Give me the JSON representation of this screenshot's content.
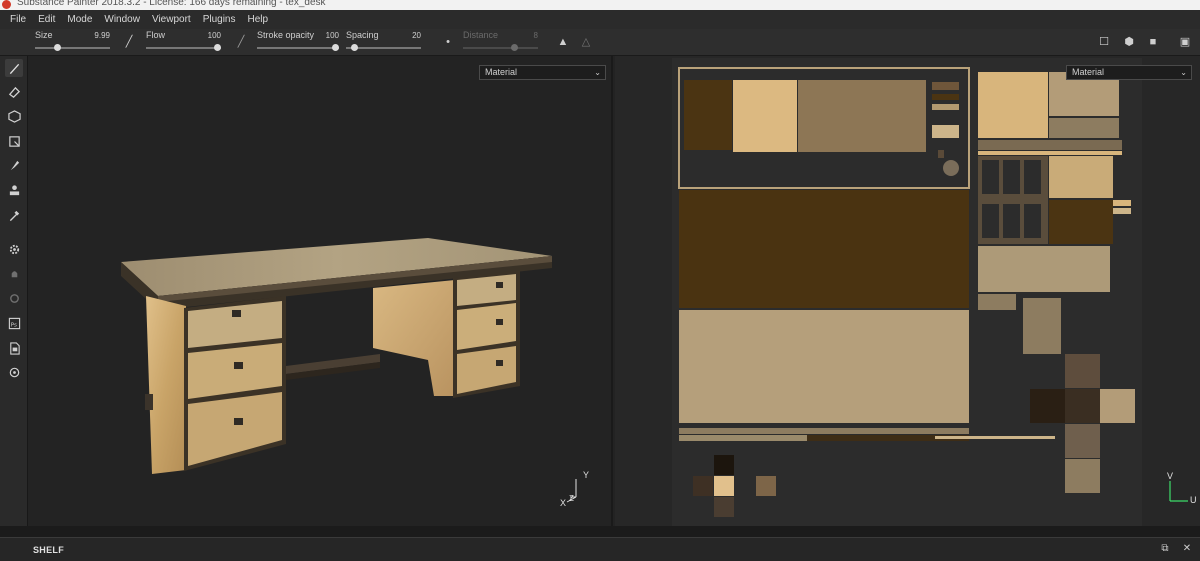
{
  "window": {
    "title": "Substance Painter 2018.3.2 - License: 166 days remaining - tex_desk"
  },
  "menu": {
    "items": [
      "File",
      "Edit",
      "Mode",
      "Window",
      "Viewport",
      "Plugins",
      "Help"
    ]
  },
  "toolbar": {
    "size": {
      "label": "Size",
      "value": "9.99",
      "level": 0.28
    },
    "flow": {
      "label": "Flow",
      "value": "100",
      "level": 1.0
    },
    "stroke_opacity": {
      "label": "Stroke opacity",
      "value": "100",
      "level": 1.0
    },
    "spacing": {
      "label": "Spacing",
      "value": "20",
      "level": 0.08
    },
    "distance": {
      "label": "Distance",
      "value": "8",
      "level": 0.7
    }
  },
  "viewport3d": {
    "channel_select": "Material",
    "axis": {
      "x": "X",
      "y": "Y",
      "z": "Z"
    }
  },
  "viewport2d": {
    "channel_select": "Material",
    "axis": {
      "y": "V",
      "x": "U"
    }
  },
  "shelf": {
    "title": "SHELF"
  },
  "colors": {
    "wood_light": "#d9b77c",
    "wood_mid": "#b89a6a",
    "wood_dark": "#4a3311",
    "wood_grey": "#8d7c60",
    "top_surface": "#a99a7c"
  }
}
